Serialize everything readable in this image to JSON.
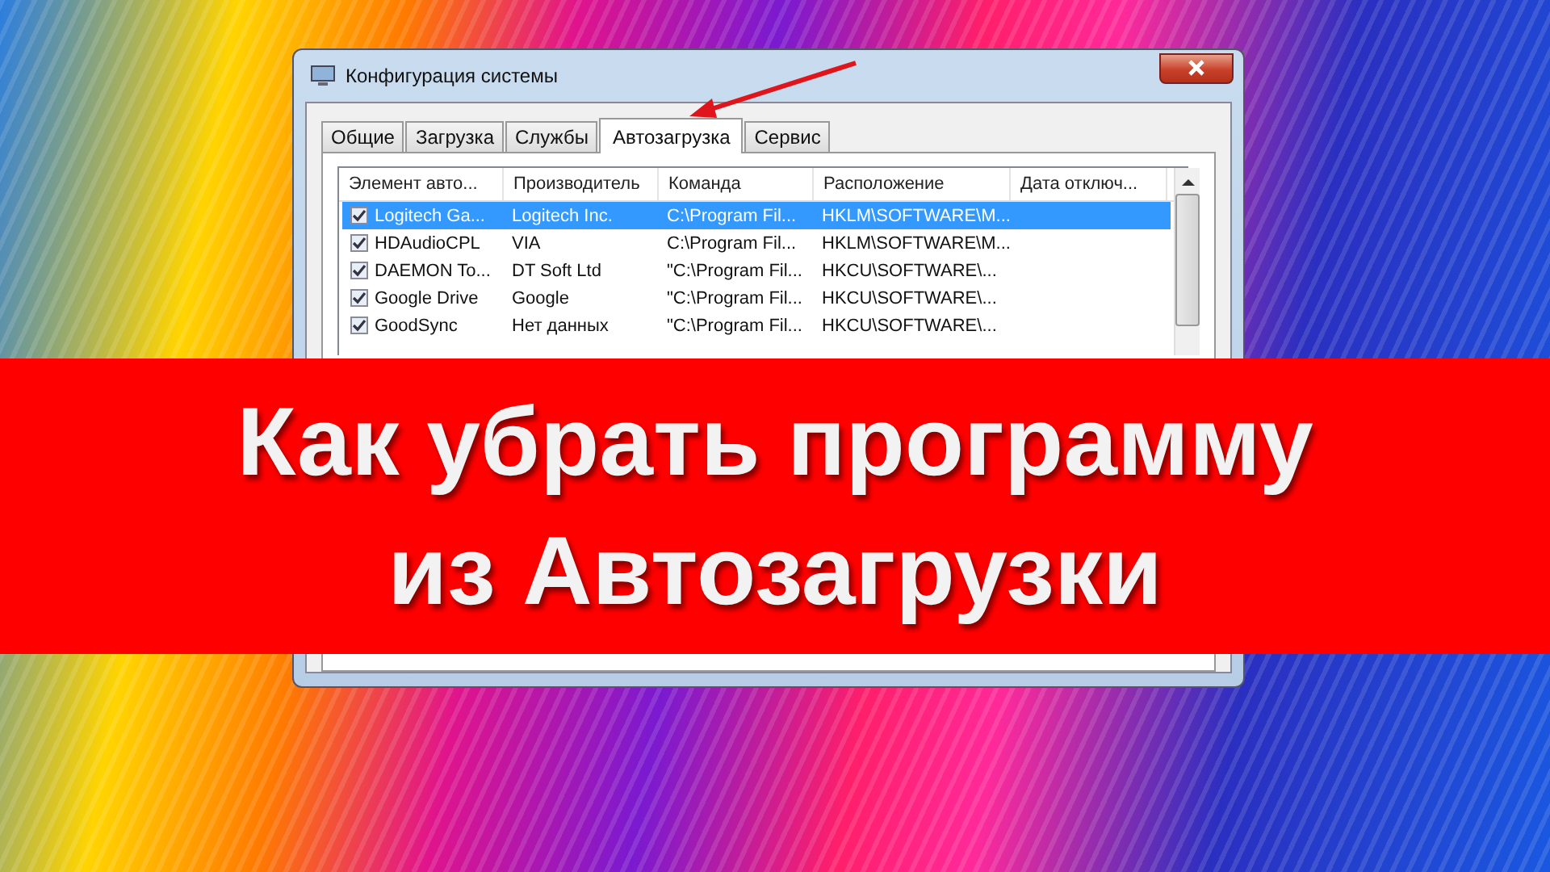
{
  "window": {
    "title": "Конфигурация системы"
  },
  "tabs": [
    {
      "label": "Общие",
      "selected": false
    },
    {
      "label": "Загрузка",
      "selected": false
    },
    {
      "label": "Службы",
      "selected": false
    },
    {
      "label": "Автозагрузка",
      "selected": true
    },
    {
      "label": "Сервис",
      "selected": false
    }
  ],
  "table": {
    "columns": [
      "Элемент авто...",
      "Производитель",
      "Команда",
      "Расположение",
      "Дата отключ..."
    ],
    "rows": [
      {
        "checked": true,
        "selected": true,
        "cells": [
          "Logitech Ga...",
          "Logitech Inc.",
          "C:\\Program Fil...",
          "HKLM\\SOFTWARE\\M..."
        ]
      },
      {
        "checked": true,
        "selected": false,
        "cells": [
          "HDAudioCPL",
          "VIA",
          "C:\\Program Fil...",
          "HKLM\\SOFTWARE\\M..."
        ]
      },
      {
        "checked": true,
        "selected": false,
        "cells": [
          "DAEMON To...",
          "DT Soft Ltd",
          "\"C:\\Program Fil...",
          "HKCU\\SOFTWARE\\..."
        ]
      },
      {
        "checked": true,
        "selected": false,
        "cells": [
          "Google Drive",
          "Google",
          "\"C:\\Program Fil...",
          "HKCU\\SOFTWARE\\..."
        ]
      },
      {
        "checked": true,
        "selected": false,
        "cells": [
          "GoodSync",
          "Нет данных",
          "\"C:\\Program Fil...",
          "HKCU\\SOFTWARE\\..."
        ]
      }
    ]
  },
  "banner": {
    "lines": [
      "Как убрать программу",
      "из Автозагрузки"
    ]
  }
}
